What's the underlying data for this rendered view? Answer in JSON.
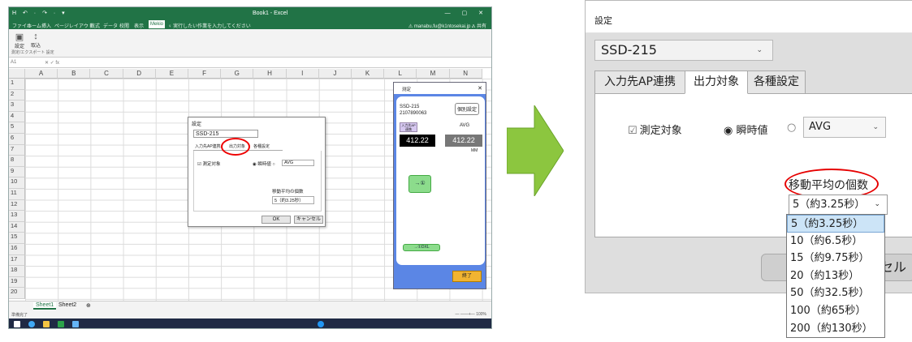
{
  "excel": {
    "qat": "H ↶ · ↷ · ▾",
    "title": "Book1 - Excel",
    "window_buttons": "—  ▢  ✕",
    "menu": [
      "ファイル",
      "ホーム",
      "挿入",
      "ページレイアウト",
      "数式",
      "データ",
      "校閲",
      "表示",
      "Mekio"
    ],
    "active_menu": "Mekio",
    "tell_me": "♀ 実行したい作業を入力してください",
    "user": "⚠ manabu.fu@k1ntosekai.jp   Ⲁ 共有",
    "ribbon_buttons": [
      {
        "icon": "▣",
        "label": "設定"
      },
      {
        "icon": "↕",
        "label": "取込"
      }
    ],
    "ribbon_group": "測定/エクスポート   設定",
    "name_box": "A1",
    "fx": "✕  ✓  fx",
    "columns": [
      "A",
      "B",
      "C",
      "D",
      "E",
      "F",
      "G",
      "H",
      "I",
      "J",
      "K",
      "L",
      "M",
      "N"
    ],
    "rows": [
      "1",
      "2",
      "3",
      "4",
      "5",
      "6",
      "7",
      "8",
      "9",
      "10",
      "11",
      "12",
      "13",
      "14",
      "15",
      "16",
      "17",
      "18",
      "19",
      "20"
    ],
    "sheets": [
      "Sheet1",
      "Sheet2",
      "⊕"
    ],
    "status": "準備完了",
    "zoom": "— ——+— 100%"
  },
  "mini_dialog": {
    "title": "設定",
    "device": "SSD-215",
    "tabs": [
      "入力先AP連携",
      "出力対象",
      "各種設定"
    ],
    "checkbox": "☑ 測定対象",
    "radio": "◉ 瞬時値 ○",
    "avg": "AVG",
    "ma_label": "移動平均の個数",
    "ma_value": "5（約3.25秒）",
    "ok": "OK",
    "cancel": "キャンセル"
  },
  "device_panel": {
    "title": "测定",
    "close": "✕",
    "device": "SSD-215",
    "serial": "2107890063",
    "settings_btn": "個別設定",
    "tag": "入力先AP連携",
    "avg": "AVG",
    "value1": "412.22",
    "value2": "412.22",
    "unit": "MM",
    "measure_btn": "→①",
    "dxl": "→①DXL",
    "end_btn": "終了"
  },
  "dialog": {
    "title": "設定",
    "device_select": "SSD-215",
    "tabs": [
      "入力先AP連携",
      "出力対象",
      "各種設定"
    ],
    "active_tab": "出力対象",
    "checkbox_label": "測定対象",
    "checkbox_glyph": "☑",
    "radio_instant": "◉ 瞬時値",
    "radio_avg": "○",
    "avg_value": "AVG",
    "ma_label": "移動平均の個数",
    "ma_value": "5（約3.25秒）",
    "cancel_partial": "セル"
  },
  "dropdown": {
    "options": [
      "5（約3.25秒）",
      "10（約6.5秒）",
      "15（約9.75秒）",
      "20（約13秒）",
      "50（約32.5秒）",
      "100（約65秒）",
      "200（約130秒）"
    ],
    "selected_index": 0
  },
  "colors": {
    "excel_green": "#217346",
    "arrow_green": "#8cc63f",
    "highlight_red": "#e60000",
    "panel_blue": "#5b86e5",
    "selected_option_bg": "#cce4f7"
  }
}
